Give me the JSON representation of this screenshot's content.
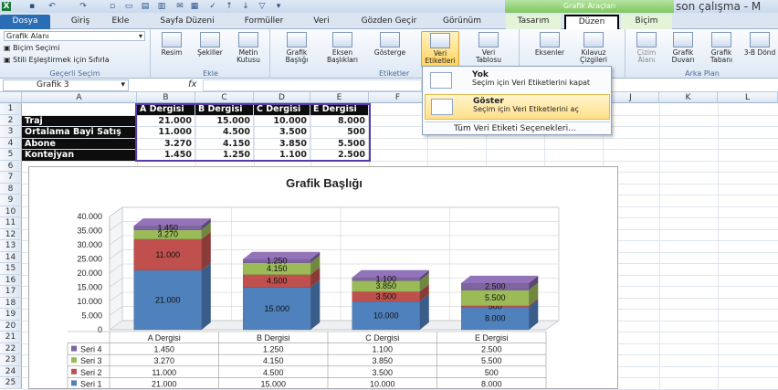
{
  "window": {
    "title": "son çalışma - M",
    "context_group": "Grafik Araçları"
  },
  "tabs": [
    "Dosya",
    "Giriş",
    "Ekle",
    "Sayfa Düzeni",
    "Formüller",
    "Veri",
    "Gözden Geçir",
    "Görünüm",
    "Tasarım",
    "Düzen",
    "Biçim"
  ],
  "ribbon": {
    "selection": {
      "dropdown_value": "Grafik Alanı",
      "format": "Biçim Seçimi",
      "reset": "Stili Eşleştirmek için Sıfırla",
      "label": "Geçerli Seçim"
    },
    "insert": {
      "buttons": [
        "Resim",
        "Şekiller",
        "Metin Kutusu"
      ],
      "label": "Ekle"
    },
    "labels": {
      "buttons": [
        "Grafik Başlığı",
        "Eksen Başlıkları",
        "Gösterge",
        "Veri Etiketleri",
        "Veri Tablosu"
      ],
      "label": "Etiketler"
    },
    "axes": {
      "buttons": [
        "Eksenler",
        "Kılavuz Çizgileri"
      ]
    },
    "background": {
      "buttons": [
        "Çizim Alanı",
        "Grafik Duvarı",
        "Grafik Tabanı",
        "3-B Dönd"
      ],
      "label": "Arka Plan"
    }
  },
  "dropdown": {
    "items": [
      {
        "title": "Yok",
        "desc": "Seçim için Veri Etiketlerini kapat"
      },
      {
        "title": "Göster",
        "desc": "Seçim için Veri Etiketlerini aç"
      }
    ],
    "more": "Tüm Veri Etiketi Seçenekleri..."
  },
  "formula_bar": {
    "name_box": "Grafik 3",
    "fx": "fx"
  },
  "columns": [
    "A",
    "B",
    "C",
    "D",
    "E",
    "F",
    "G",
    "H",
    "I",
    "J",
    "K",
    "L"
  ],
  "rows": [
    "1",
    "2",
    "3",
    "4",
    "5",
    "6",
    "7",
    "8",
    "9",
    "10",
    "11",
    "12",
    "13",
    "14",
    "15",
    "16",
    "17",
    "18",
    "19",
    "20",
    "21",
    "22",
    "23",
    "24",
    "25"
  ],
  "sheet": {
    "headers": [
      "A Dergisi",
      "B Dergisi",
      "C Dergisi",
      "E Dergisi"
    ],
    "rows": [
      {
        "label": "Traj",
        "values": [
          "21.000",
          "15.000",
          "10.000",
          "8.000"
        ]
      },
      {
        "label": "Ortalama Bayi Satış",
        "values": [
          "11.000",
          "4.500",
          "3.500",
          "500"
        ]
      },
      {
        "label": "Abone",
        "values": [
          "3.270",
          "4.150",
          "3.850",
          "5.500"
        ]
      },
      {
        "label": "Kontejyan",
        "values": [
          "1.450",
          "1.250",
          "1.100",
          "2.500"
        ]
      }
    ]
  },
  "chart_data": {
    "type": "bar",
    "stacked": true,
    "three_d": true,
    "title": "Grafik Başlığı",
    "categories": [
      "A Dergisi",
      "B Dergisi",
      "C Dergisi",
      "E Dergisi"
    ],
    "series": [
      {
        "name": "Seri 1",
        "values": [
          21000,
          15000,
          10000,
          8000
        ],
        "color": "#4f81bd"
      },
      {
        "name": "Seri 2",
        "values": [
          11000,
          4500,
          3500,
          500
        ],
        "color": "#c0504d"
      },
      {
        "name": "Seri 3",
        "values": [
          3270,
          4150,
          3850,
          5500
        ],
        "color": "#9bbb59"
      },
      {
        "name": "Seri 4",
        "values": [
          1450,
          1250,
          1100,
          2500
        ],
        "color": "#8064a2"
      }
    ],
    "data_labels": [
      [
        "21.000",
        "15.000",
        "10.000",
        "8.000"
      ],
      [
        "11.000",
        "4.500",
        "3.500",
        "500"
      ],
      [
        "3.270",
        "4.150",
        "3.850",
        "5.500"
      ],
      [
        "1.450",
        "1.250",
        "1.100",
        "2.500"
      ]
    ],
    "yticks": [
      "0",
      "5.000",
      "10.000",
      "15.000",
      "20.000",
      "25.000",
      "30.000",
      "35.000",
      "40.000"
    ],
    "ylim": [
      0,
      40000
    ],
    "grid": true,
    "data_table": true
  }
}
